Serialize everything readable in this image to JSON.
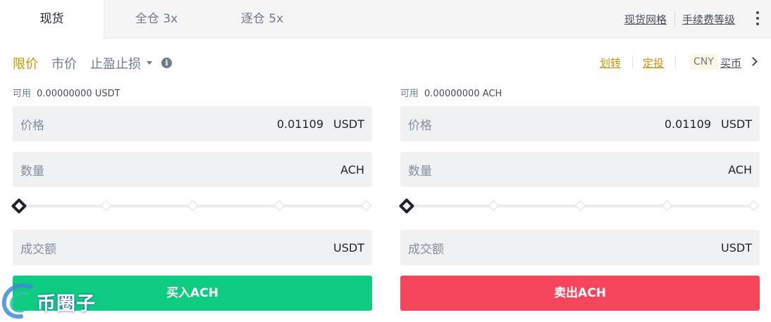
{
  "tabs": {
    "spot": "现货",
    "cross": "全仓 3x",
    "isolated": "逐仓 5x"
  },
  "top_links": {
    "spot_grid": "现货网格",
    "fee_level": "手续费等级",
    "more_icon": "more-vertical-icon"
  },
  "order_types": {
    "limit": "限价",
    "market": "市价",
    "stop": "止盈止损",
    "active": "limit"
  },
  "right_links": {
    "transfer": "划转",
    "auto_invest": "定投",
    "fiat": "CNY",
    "buy_crypto": "买币"
  },
  "buy": {
    "available_label": "可用",
    "available_value": "0.00000000 USDT",
    "price_label": "价格",
    "price_value": "0.01109",
    "price_unit": "USDT",
    "qty_label": "数量",
    "qty_unit": "ACH",
    "total_label": "成交额",
    "total_unit": "USDT",
    "slider_percent": 0,
    "button": "买入ACH"
  },
  "sell": {
    "available_label": "可用",
    "available_value": "0.00000000 ACH",
    "price_label": "价格",
    "price_value": "0.01109",
    "price_unit": "USDT",
    "qty_label": "数量",
    "qty_unit": "ACH",
    "total_label": "成交额",
    "total_unit": "USDT",
    "slider_percent": 0,
    "button": "卖出ACH"
  },
  "watermark": {
    "text": "币圈子"
  },
  "colors": {
    "accent": "#c99400",
    "buy": "#0ecb81",
    "sell": "#f6465d",
    "field_bg": "#f0f1f2"
  }
}
